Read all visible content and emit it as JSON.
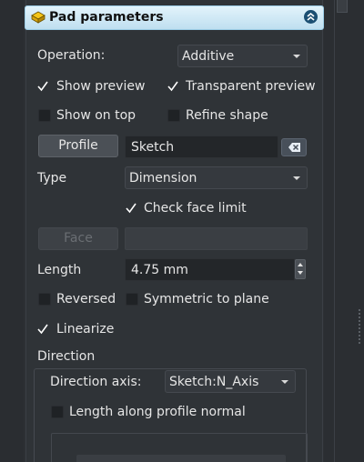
{
  "header": {
    "title": "Pad parameters",
    "icon": "pad-icon",
    "collapse_icon": "collapse-icon"
  },
  "operation": {
    "label": "Operation:",
    "value": "Additive"
  },
  "show_preview": {
    "label": "Show preview",
    "checked": true
  },
  "transparent_preview": {
    "label": "Transparent preview",
    "checked": true
  },
  "show_on_top": {
    "label": "Show on top",
    "checked": false
  },
  "refine_shape": {
    "label": "Refine shape",
    "checked": false
  },
  "profile": {
    "button": "Profile",
    "value": "Sketch",
    "clear_icon": "clear-icon"
  },
  "type": {
    "label": "Type",
    "value": "Dimension"
  },
  "check_face_limit": {
    "label": "Check face limit",
    "checked": true
  },
  "face": {
    "button": "Face",
    "value": ""
  },
  "length": {
    "label": "Length",
    "value": "4.75 mm"
  },
  "reversed": {
    "label": "Reversed",
    "checked": false
  },
  "symmetric": {
    "label": "Symmetric to plane",
    "checked": false
  },
  "linearize": {
    "label": "Linearize",
    "checked": true
  },
  "direction": {
    "title": "Direction",
    "axis_label": "Direction axis:",
    "axis_value": "Sketch:N_Axis",
    "length_along_normal": {
      "label": "Length along profile normal",
      "checked": false
    }
  },
  "colors": {
    "header_bg": "#d4ecf7",
    "panel_bg": "#2f3337",
    "field_bg": "#232629",
    "accent": "#1b4f73"
  }
}
